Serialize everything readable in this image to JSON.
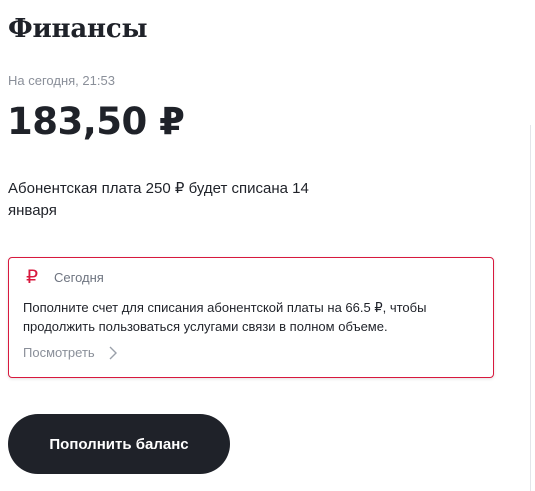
{
  "header": {
    "title": "Финансы"
  },
  "balance": {
    "timestamp": "На сегодня, 21:53",
    "amount": "183,50 ₽",
    "fee_note": "Абонентская плата 250 ₽ будет списана 14 января"
  },
  "alert": {
    "icon": "ruble-icon",
    "icon_glyph": "₽",
    "date": "Сегодня",
    "text": "Пополните счет для списания абонентской платы на 66.5 ₽, чтобы продолжить пользоваться услугами связи в полном объеме.",
    "link_label": "Посмотреть",
    "accent_color": "#d8193e"
  },
  "actions": {
    "topup_label": "Пополнить баланс",
    "button_color": "#1f2229"
  }
}
